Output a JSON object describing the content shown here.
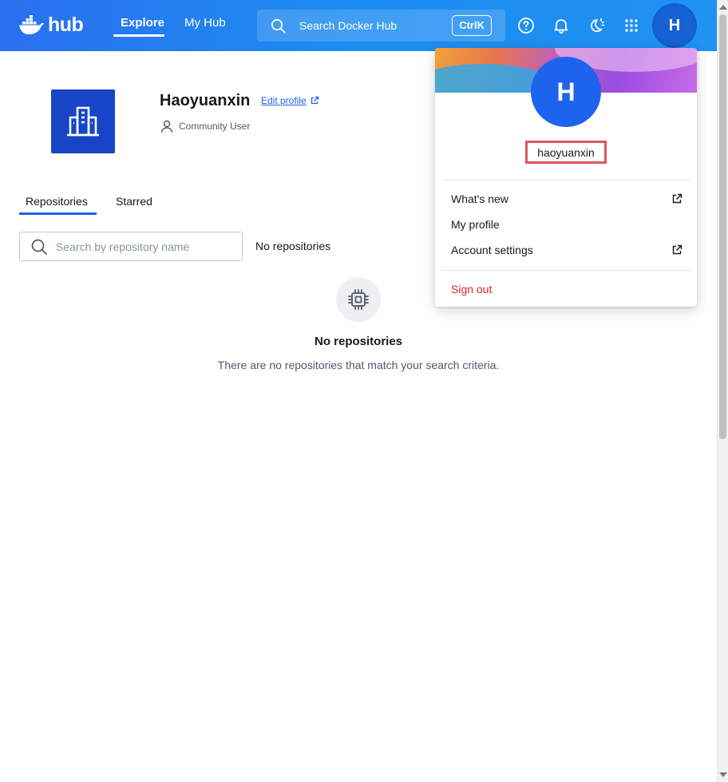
{
  "header": {
    "logo_text": "hub",
    "nav": {
      "explore": "Explore",
      "my_hub": "My Hub"
    },
    "search": {
      "placeholder": "Search Docker Hub",
      "shortcut": "CtrlK"
    },
    "avatar_initial": "H"
  },
  "profile": {
    "name": "Haoyuanxin",
    "edit_link": "Edit profile",
    "role": "Community User"
  },
  "tabs": {
    "repositories": "Repositories",
    "starred": "Starred"
  },
  "repo_search": {
    "placeholder": "Search by repository name"
  },
  "repo_count_text": "No repositories",
  "empty_state": {
    "title": "No repositories",
    "subtitle": "There are no repositories that match your search criteria."
  },
  "dropdown": {
    "avatar_initial": "H",
    "username": "haoyuanxin",
    "items": {
      "whats_new": "What's new",
      "my_profile": "My profile",
      "account_settings": "Account settings",
      "sign_out": "Sign out"
    }
  },
  "colors": {
    "header_start": "#2a6ff0",
    "header_end": "#1f92f3",
    "accent": "#1d63ed",
    "org_avatar": "#1845c8",
    "sign_out": "#d52536",
    "highlight_box": "#e0565b"
  }
}
